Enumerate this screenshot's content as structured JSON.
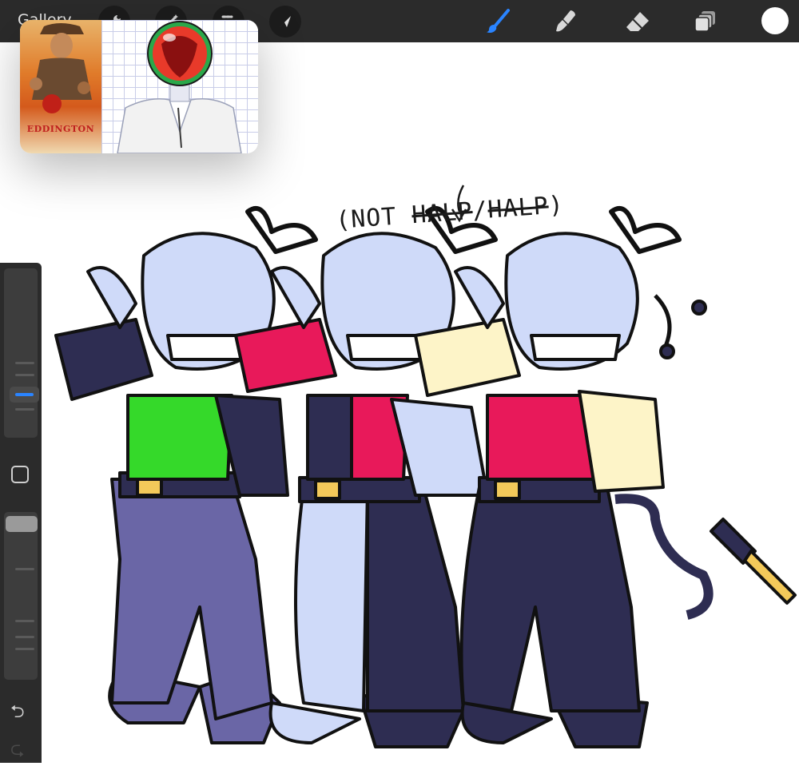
{
  "toolbar": {
    "gallery_label": "Gallery",
    "left_icons": [
      "wrench-icon",
      "magic-wand-icon",
      "selection-icon",
      "move-arrow-icon"
    ],
    "right_icons": [
      "brush-icon",
      "smudge-icon",
      "eraser-icon",
      "layers-icon",
      "color-icon"
    ],
    "active_tool_color": "#2a84ff",
    "current_color": "#ffffff"
  },
  "reference": {
    "poster_title": "EDDINGTON"
  },
  "canvas": {
    "caption_open": "(NOT ",
    "caption_struck1": "HALP",
    "caption_sep": "/",
    "caption_struck2": "HALP",
    "caption_close": ")"
  },
  "sidebar": {
    "undo_symbol": "⮌",
    "redo_symbol": "⮎"
  },
  "colors": {
    "bg_dark": "#2b2b2b",
    "green_top": "#35d92a",
    "navy": "#2e2d52",
    "pink": "#e8195a",
    "cream": "#fdf4c8",
    "pale_blue": "#cfdaf9",
    "purple_pants": "#6a66a6",
    "belt_buckle": "#f3c95a"
  }
}
